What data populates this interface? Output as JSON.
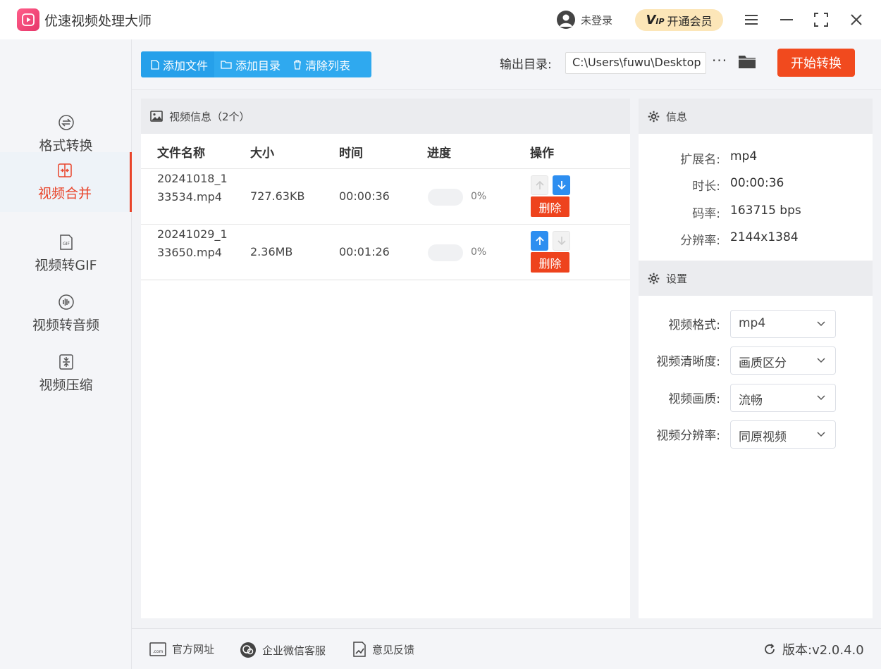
{
  "app": {
    "title": "优速视频处理大师"
  },
  "header": {
    "login_text": "未登录",
    "vip_badge": "VIP",
    "vip_label": "开通会员"
  },
  "sidebar": {
    "items": [
      {
        "label": "格式转换",
        "icon": "format-convert-icon",
        "active": false
      },
      {
        "label": "视频合并",
        "icon": "merge-icon",
        "active": true
      },
      {
        "label": "视频转GIF",
        "icon": "gif-icon",
        "active": false
      },
      {
        "label": "视频转音频",
        "icon": "audio-icon",
        "active": false
      },
      {
        "label": "视频压缩",
        "icon": "compress-icon",
        "active": false
      }
    ]
  },
  "toolbar": {
    "add_file": "添加文件",
    "add_dir": "添加目录",
    "clear_list": "清除列表",
    "output_label": "输出目录:",
    "output_path": "C:\\Users\\fuwu\\Desktop",
    "more": "···",
    "start": "开始转换"
  },
  "list": {
    "title": "视频信息（2个）",
    "columns": {
      "name": "文件名称",
      "size": "大小",
      "time": "时间",
      "progress": "进度",
      "action": "操作"
    },
    "rows": [
      {
        "name": "20241018_133534.mp4",
        "size": "727.63KB",
        "time": "00:00:36",
        "progress_text": "0%",
        "progress": 0,
        "up_enabled": false,
        "down_enabled": true,
        "delete": "删除"
      },
      {
        "name": "20241029_133650.mp4",
        "size": "2.36MB",
        "time": "00:01:26",
        "progress_text": "0%",
        "progress": 0,
        "up_enabled": true,
        "down_enabled": false,
        "delete": "删除"
      }
    ]
  },
  "info": {
    "title": "信息",
    "ext_label": "扩展名:",
    "ext": "mp4",
    "duration_label": "时长:",
    "duration": "00:00:36",
    "bitrate_label": "码率:",
    "bitrate": "163715 bps",
    "resolution_label": "分辨率:",
    "resolution": "2144x1384"
  },
  "settings": {
    "title": "设置",
    "format_label": "视频格式:",
    "format": "mp4",
    "clarity_label": "视频清晰度:",
    "clarity": "画质区分",
    "quality_label": "视频画质:",
    "quality": "流畅",
    "resolution_label": "视频分辨率:",
    "resolution": "同原视频"
  },
  "footer": {
    "website": "官方网址",
    "wechat": "企业微信客服",
    "feedback": "意见反馈",
    "version": "版本:v2.0.4.0"
  },
  "colors": {
    "accent": "#2fa9ef",
    "danger": "#f14a1e",
    "active": "#e9442a",
    "vip": "#fce6b8"
  }
}
